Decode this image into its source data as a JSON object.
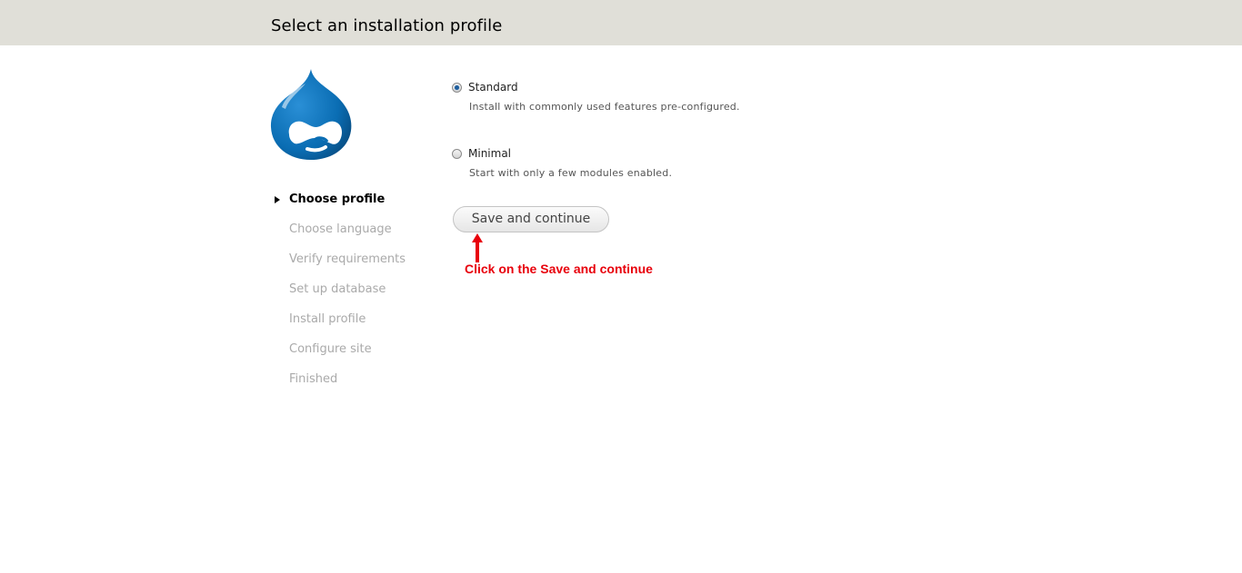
{
  "header": {
    "title": "Select an installation profile"
  },
  "logo": {
    "name": "drupal-logo",
    "color": "#0678be"
  },
  "steps": [
    {
      "label": "Choose profile",
      "active": true
    },
    {
      "label": "Choose language",
      "active": false
    },
    {
      "label": "Verify requirements",
      "active": false
    },
    {
      "label": "Set up database",
      "active": false
    },
    {
      "label": "Install profile",
      "active": false
    },
    {
      "label": "Configure site",
      "active": false
    },
    {
      "label": "Finished",
      "active": false
    }
  ],
  "profiles": [
    {
      "label": "Standard",
      "description": "Install with commonly used features pre-configured.",
      "checked": true
    },
    {
      "label": "Minimal",
      "description": "Start with only a few modules enabled.",
      "checked": false
    }
  ],
  "actions": {
    "save_label": "Save and continue"
  },
  "annotation": {
    "text": "Click on the Save and continue",
    "color": "#e8000b"
  }
}
